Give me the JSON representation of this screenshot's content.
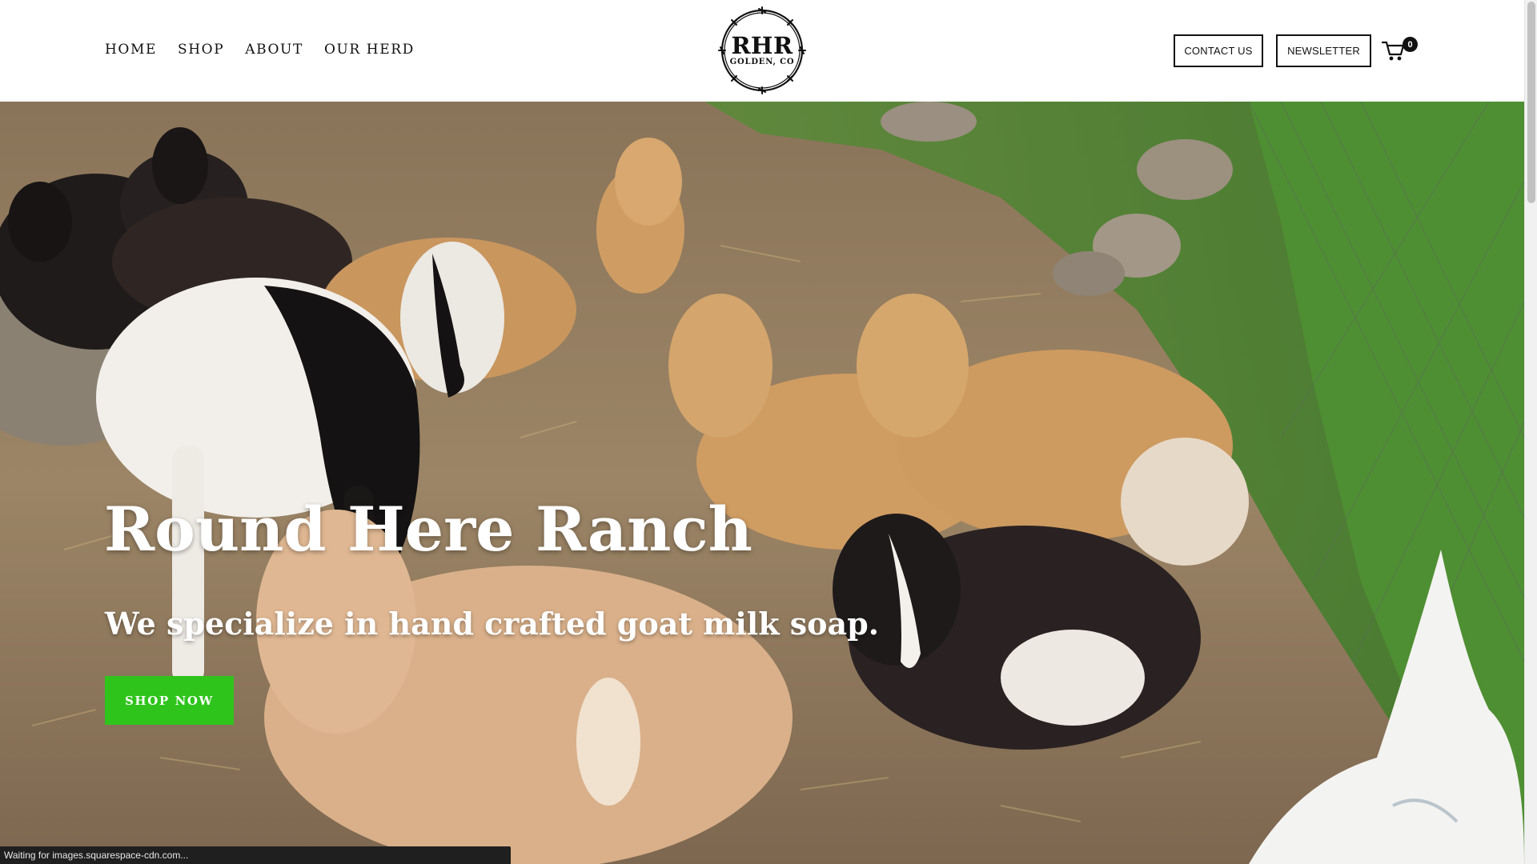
{
  "nav": {
    "items": [
      {
        "label": "HOME"
      },
      {
        "label": "SHOP"
      },
      {
        "label": "ABOUT"
      },
      {
        "label": "OUR HERD"
      }
    ]
  },
  "logo": {
    "main": "RHR",
    "sub": "GOLDEN, CO"
  },
  "header_buttons": {
    "contact": "CONTACT US",
    "newsletter": "NEWSLETTER"
  },
  "cart": {
    "icon": "cart-icon",
    "count": "0"
  },
  "hero": {
    "title": "Round Here Ranch",
    "subtitle": "We specialize in hand crafted goat milk soap.",
    "cta": "SHOP NOW",
    "cta_color": "#2fc41c"
  },
  "status_bar": {
    "text": "Waiting for images.squarespace-cdn.com..."
  }
}
